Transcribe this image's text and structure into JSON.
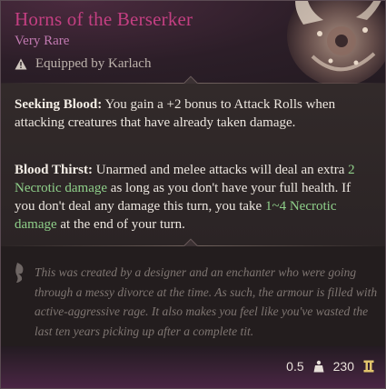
{
  "item": {
    "title": "Horns of the Berserker",
    "rarity": "Very Rare",
    "equipped_by": "Equipped by Karlach"
  },
  "icons": {
    "equipped": "warning-triangle-icon",
    "lore": "feather-icon",
    "weight": "weight-icon",
    "value": "gold-coin-icon"
  },
  "effects": [
    {
      "name": "Seeking Blood:",
      "text_before": " You gain a +2 bonus to Attack Rolls when attacking creatures that have already taken damage."
    },
    {
      "name": "Blood Thirst:",
      "text_1": " Unarmed and melee attacks will deal an extra ",
      "highlight_1": "2 Necrotic damage",
      "text_2": " as long as you don't have your full health. If you don't deal any damage this turn, you take ",
      "highlight_2": "1~4 Necrotic damage",
      "text_3": " at the end of your turn."
    }
  ],
  "lore": "This was created by a designer and an enchanter who were going through a messy divorce at the time. As such, the armour is filled with active-aggressive rage. It also makes you feel like you've wasted the last ten years picking up after a complete tit.",
  "footer": {
    "weight": "0.5",
    "value": "230"
  },
  "colors": {
    "title": "#c43f82",
    "rarity": "#c27ab2",
    "highlight": "#8fd08a",
    "lore": "#7f7672"
  }
}
